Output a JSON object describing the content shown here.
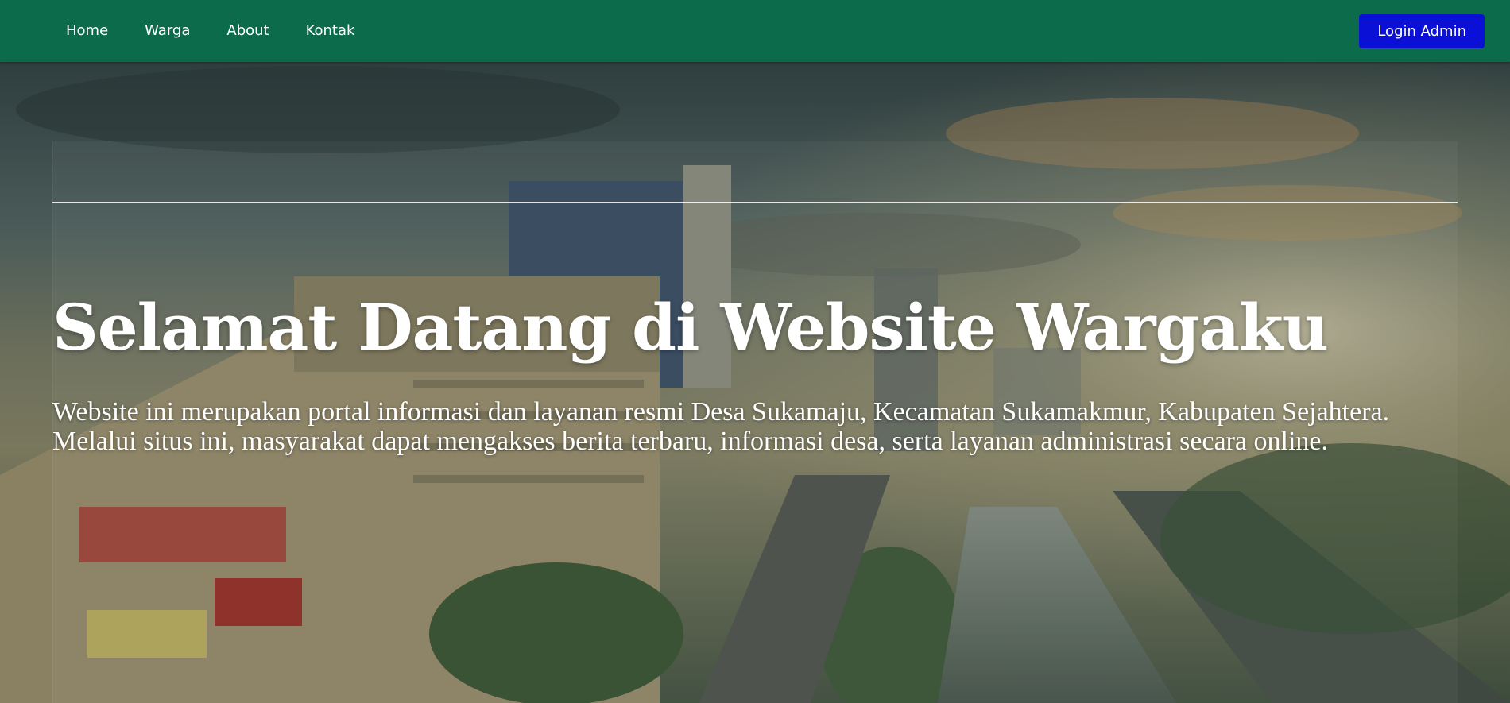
{
  "navbar": {
    "links": [
      "Home",
      "Warga",
      "About",
      "Kontak"
    ],
    "login_label": "Login Admin",
    "background_color": "#0b6b4b",
    "login_color": "#0a10d6"
  },
  "hero": {
    "title": "Selamat Datang di Website Wargaku",
    "description": "Website ini merupakan portal informasi dan layanan resmi Desa Sukamaju, Kecamatan Sukamakmur, Kabupaten Sejahtera. Melalui situs ini, masyarakat dapat mengakses berita terbaru, informasi desa, serta layanan administrasi secara online."
  }
}
